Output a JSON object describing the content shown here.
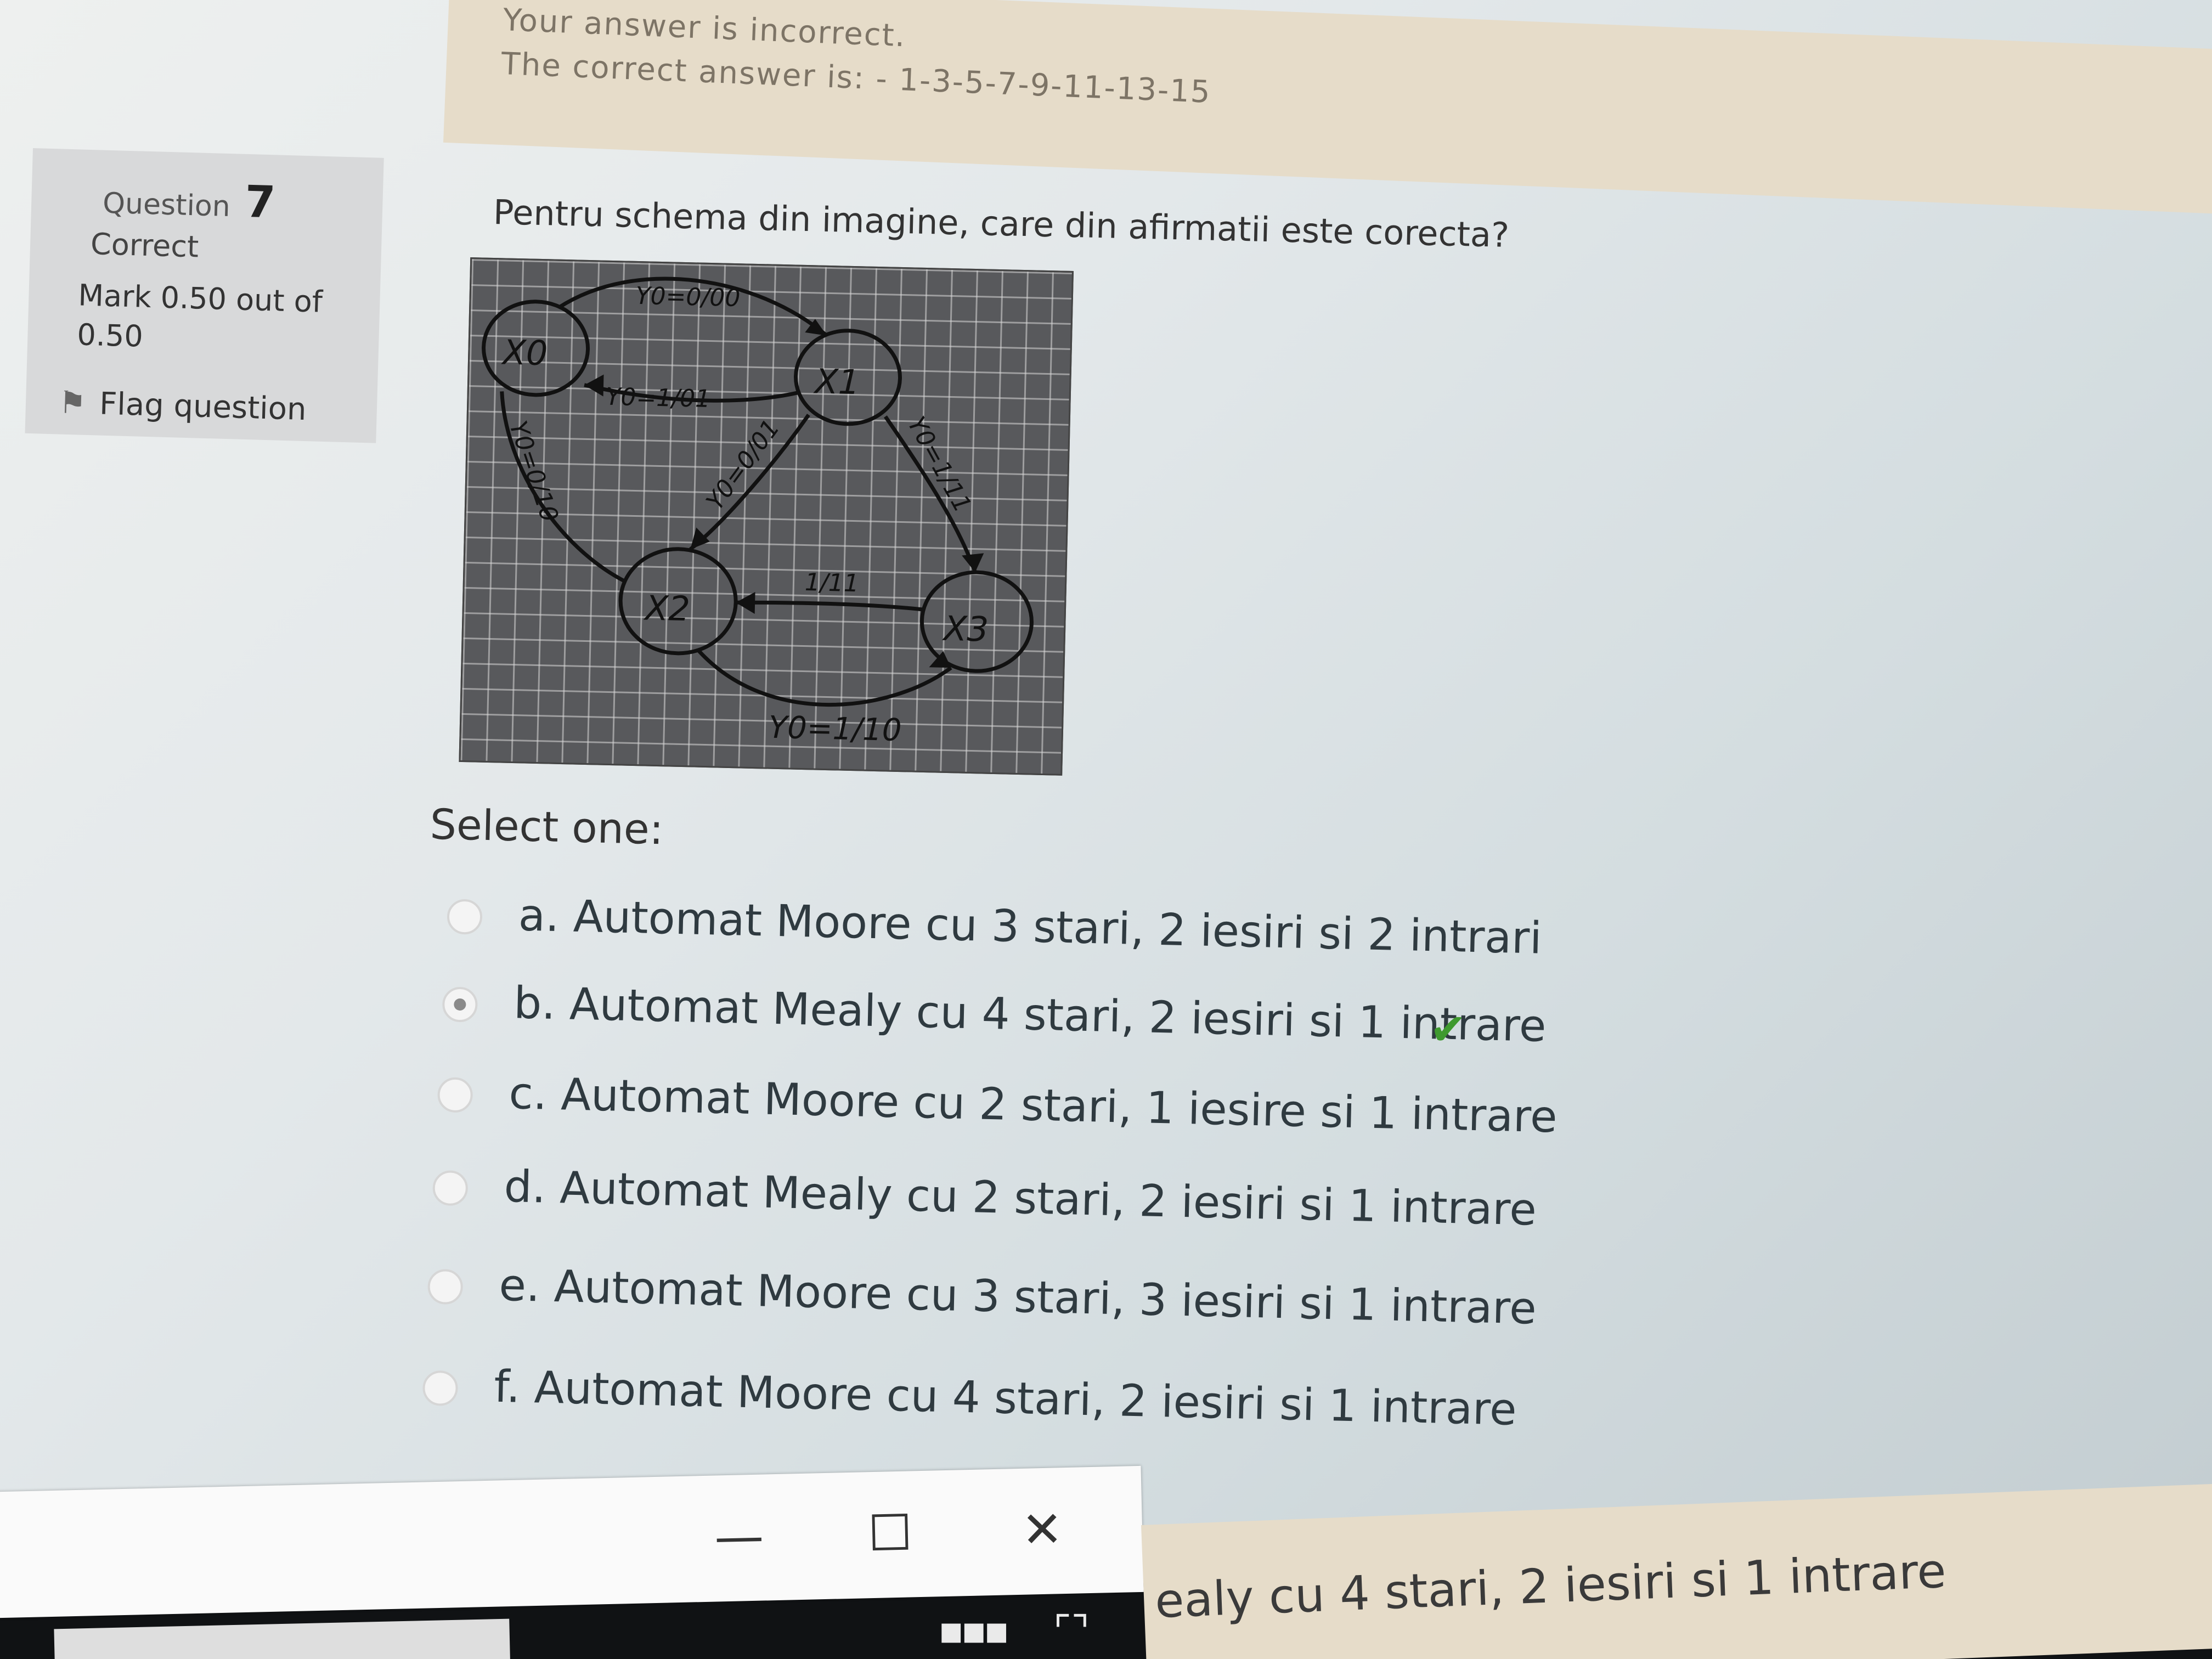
{
  "feedback": {
    "incorrect_text": "Your answer is incorrect.",
    "correct_answer_label": "The correct answer is:",
    "correct_answer_value": "- 1-3-5-7-9-11-13-15"
  },
  "question_info": {
    "question_word": "Question",
    "question_number": "7",
    "state": "Correct",
    "mark": "Mark 0.50 out of 0.50",
    "flag_label": "Flag question"
  },
  "question": {
    "text": "Pentru schema din imagine, care din afirmatii este corecta?",
    "select_one": "Select one:",
    "options": [
      {
        "label": "a. Automat Moore cu 3 stari, 2 iesiri si 2 intrari",
        "selected": false,
        "correct": false
      },
      {
        "label": "b. Automat Mealy cu 4 stari, 2 iesiri si 1 intrare",
        "selected": true,
        "correct": true
      },
      {
        "label": "c. Automat Moore cu 2 stari, 1 iesire si 1 intrare",
        "selected": false,
        "correct": false
      },
      {
        "label": "d. Automat Mealy cu 2 stari, 2 iesiri si 1 intrare",
        "selected": false,
        "correct": false
      },
      {
        "label": "e. Automat Moore cu 3 stari, 3 iesiri si 1 intrare",
        "selected": false,
        "correct": false
      },
      {
        "label": "f. Automat Moore cu 4 stari, 2 iesiri si 1 intrare",
        "selected": false,
        "correct": false
      }
    ],
    "correct_check_icon": "checkmark-icon",
    "correct_color": "#3f9a2f"
  },
  "diagram": {
    "states": [
      "X0",
      "X1",
      "X2",
      "X3"
    ],
    "transitions": [
      "Y0=0/00",
      "Y0=1/01",
      "Y0=0/01",
      "Y0=0/10",
      "Y0=1/11",
      "1/11",
      "Y0=1/10"
    ]
  },
  "window_controls": {
    "minimize": "—",
    "maximize": "☐",
    "close": "✕"
  },
  "taskbar": {
    "bottom_text": "ealy cu 4 stari, 2 iesiri si 1 intrare"
  }
}
